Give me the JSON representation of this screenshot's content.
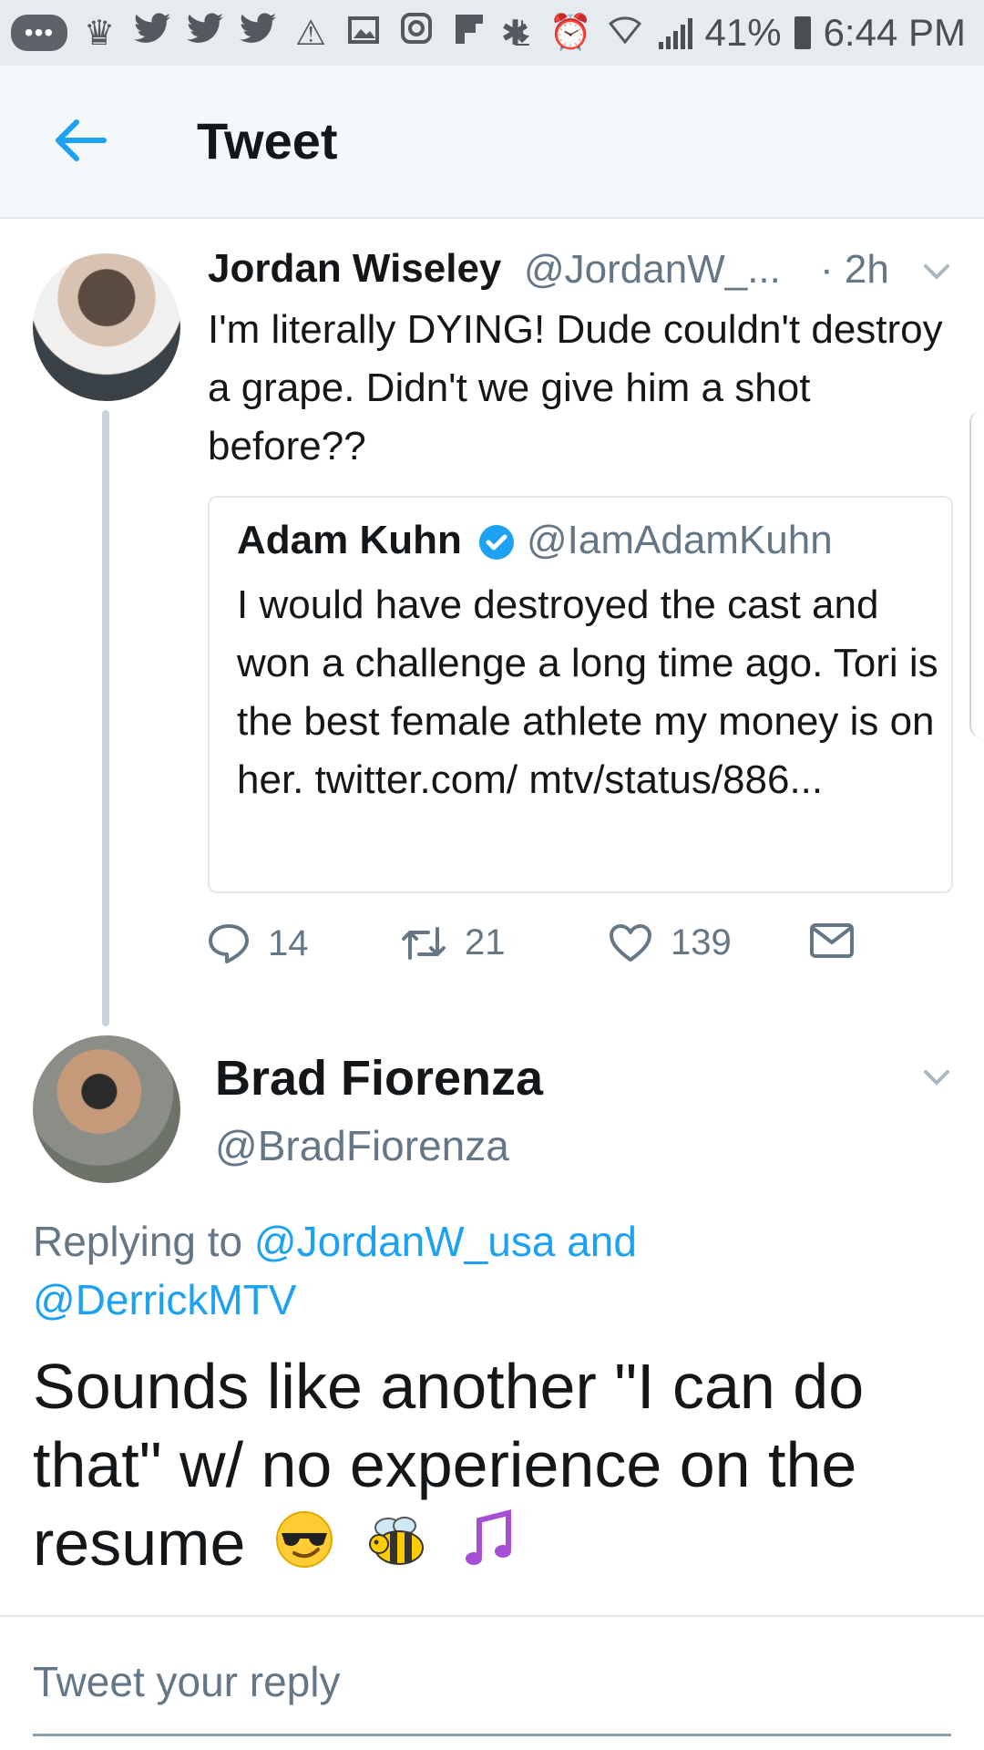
{
  "status_bar": {
    "battery": "41%",
    "time": "6:44 PM",
    "left_icons": [
      "chat-icon",
      "crown-icon",
      "twitter-icon",
      "twitter-icon",
      "twitter-icon",
      "warning-icon",
      "image-icon",
      "instagram-icon",
      "flipboard-icon",
      "download-icon"
    ],
    "right_icons": [
      "bluetooth-icon",
      "alarm-icon",
      "wifi-icon",
      "signal-icon",
      "battery-icon"
    ]
  },
  "header": {
    "title": "Tweet"
  },
  "tweet1": {
    "name": "Jordan Wiseley",
    "handle": "@JordanW_...",
    "time": "· 2h",
    "text": "I'm literally DYING! Dude couldn't destroy a grape. Didn't we give him a shot before??",
    "quote": {
      "name": "Adam Kuhn",
      "handle": "@IamAdamKuhn",
      "text": "I would have destroyed the cast and won a challenge a long time ago. Tori is the best female athlete my money is on her. twitter.com/ mtv/status/886..."
    },
    "actions": {
      "replies": "14",
      "retweets": "21",
      "likes": "139"
    },
    "colors": {
      "accent": "#1da1f2",
      "muted": "#657786"
    }
  },
  "tweet2": {
    "name": "Brad Fiorenza",
    "handle": "@BradFiorenza",
    "replying_prefix": "Replying to ",
    "replying_user1": "@JordanW_usa",
    "replying_and": " and",
    "replying_user2": "@DerrickMTV",
    "text": "Sounds like another \"I can do that\" w/ no experience on the resume",
    "emojis": [
      "sunglasses-emoji",
      "bee-emoji",
      "music-notes-emoji"
    ]
  },
  "reply": {
    "placeholder": "Tweet your reply"
  }
}
